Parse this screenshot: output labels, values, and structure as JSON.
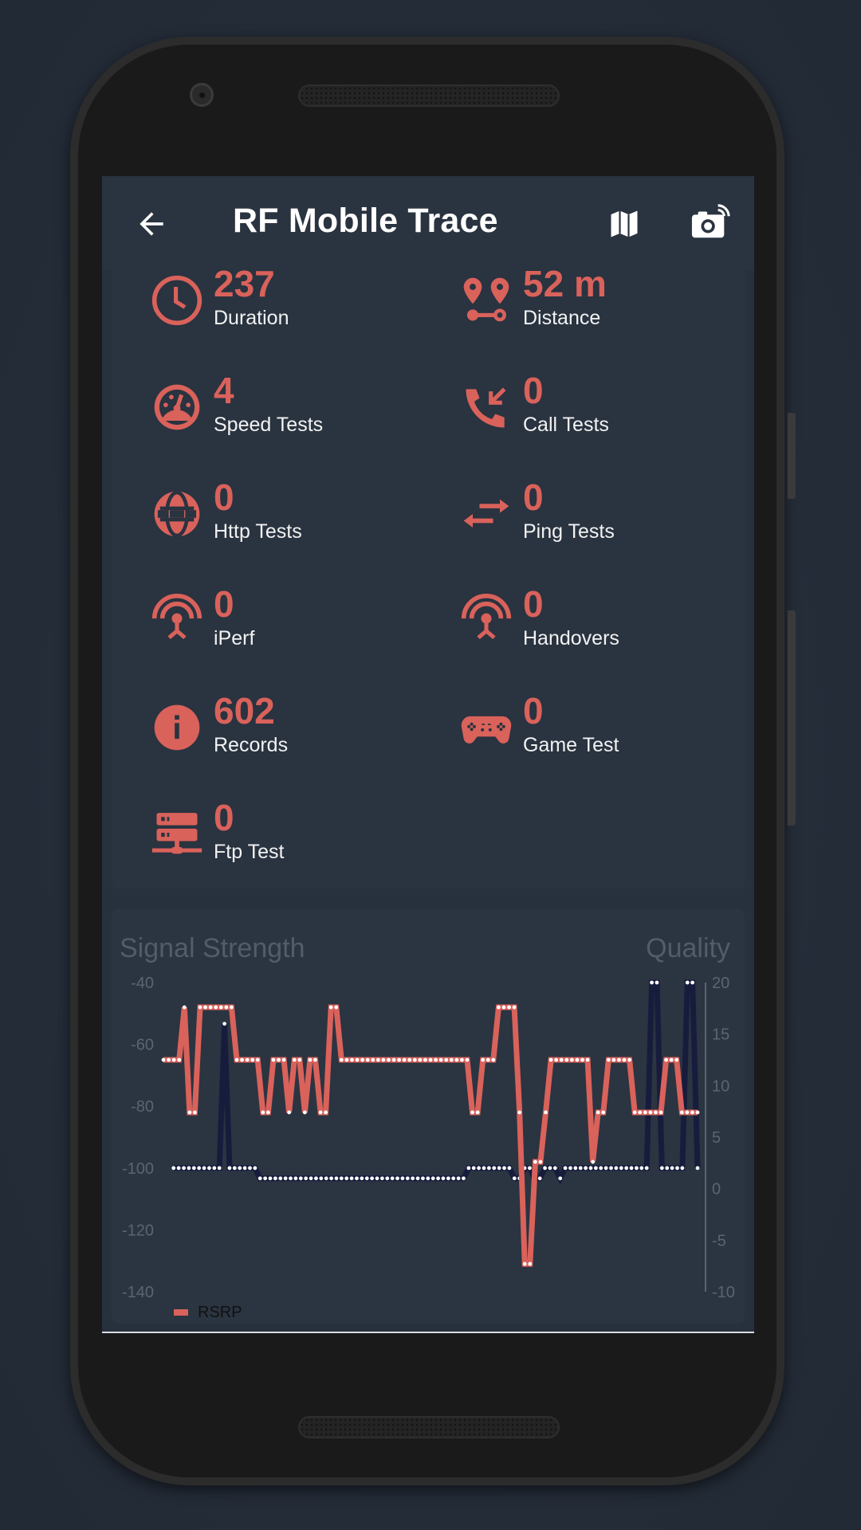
{
  "app": {
    "title": "RF Mobile Trace",
    "back_icon": "arrow-left-icon",
    "actions": [
      {
        "name": "map",
        "icon": "map-icon"
      },
      {
        "name": "camera",
        "icon": "camera-wireless-icon"
      }
    ]
  },
  "stats": [
    {
      "value": "237",
      "label": "Duration",
      "icon": "clock-icon"
    },
    {
      "value": "52 m",
      "label": "Distance",
      "icon": "route-pins-icon"
    },
    {
      "value": "4",
      "label": "Speed Tests",
      "icon": "speedometer-icon"
    },
    {
      "value": "0",
      "label": "Call Tests",
      "icon": "phone-incoming-icon"
    },
    {
      "value": "0",
      "label": "Http Tests",
      "icon": "globe-icon"
    },
    {
      "value": "0",
      "label": "Ping Tests",
      "icon": "swap-arrows-icon"
    },
    {
      "value": "0",
      "label": "iPerf",
      "icon": "antenna-icon"
    },
    {
      "value": "0",
      "label": "Handovers",
      "icon": "antenna-icon"
    },
    {
      "value": "602",
      "label": "Records",
      "icon": "info-icon"
    },
    {
      "value": "0",
      "label": "Game Test",
      "icon": "gamepad-icon"
    },
    {
      "value": "0",
      "label": "Ftp Test",
      "icon": "server-network-icon"
    }
  ],
  "colors": {
    "accent": "#d9625b",
    "background": "#27303d",
    "card": "#2a3340",
    "quality_line": "#171c3d"
  },
  "chart_data": {
    "type": "line",
    "title_left": "Signal Strength",
    "title_right": "Quality",
    "left_axis": {
      "ticks": [
        "-40",
        "-60",
        "-80",
        "-100",
        "-120",
        "-140"
      ],
      "range": [
        -140,
        -40
      ]
    },
    "right_axis": {
      "ticks": [
        "20",
        "15",
        "10",
        "5",
        "0",
        "-5",
        "-10"
      ],
      "range": [
        -10,
        20
      ]
    },
    "legend": [
      {
        "name": "RSRP",
        "color": "#d9625b",
        "position": "bottom-left"
      }
    ],
    "series": [
      {
        "name": "RSRP",
        "axis": "left",
        "values": [
          -65,
          -65,
          -65,
          -65,
          -48,
          -82,
          -82,
          -48,
          -48,
          -48,
          -48,
          -48,
          -48,
          -48,
          -65,
          -65,
          -65,
          -65,
          -65,
          -82,
          -82,
          -65,
          -65,
          -65,
          -82,
          -65,
          -65,
          -82,
          -65,
          -65,
          -82,
          -82,
          -48,
          -48,
          -65,
          -65,
          -65,
          -65,
          -65,
          -65,
          -65,
          -65,
          -65,
          -65,
          -65,
          -65,
          -65,
          -65,
          -65,
          -65,
          -65,
          -65,
          -65,
          -65,
          -65,
          -65,
          -65,
          -65,
          -65,
          -82,
          -82,
          -65,
          -65,
          -65,
          -48,
          -48,
          -48,
          -48,
          -82,
          -131,
          -131,
          -98,
          -98,
          -82,
          -65,
          -65,
          -65,
          -65,
          -65,
          -65,
          -65,
          -65,
          -98,
          -82,
          -82,
          -65,
          -65,
          -65,
          -65,
          -65,
          -82,
          -82,
          -82,
          -82,
          -82,
          -82,
          -65,
          -65,
          -65,
          -82,
          -82,
          -82,
          -82
        ]
      },
      {
        "name": "Quality",
        "axis": "right",
        "values": [
          null,
          null,
          2,
          2,
          2,
          2,
          2,
          2,
          2,
          2,
          2,
          2,
          16,
          2,
          2,
          2,
          2,
          2,
          2,
          1,
          1,
          1,
          1,
          1,
          1,
          1,
          1,
          1,
          1,
          1,
          1,
          1,
          1,
          1,
          1,
          1,
          1,
          1,
          1,
          1,
          1,
          1,
          1,
          1,
          1,
          1,
          1,
          1,
          1,
          1,
          1,
          1,
          1,
          1,
          1,
          1,
          1,
          1,
          1,
          1,
          2,
          2,
          2,
          2,
          2,
          2,
          2,
          2,
          2,
          1,
          1,
          2,
          2,
          1,
          1,
          2,
          2,
          2,
          1,
          2,
          2,
          2,
          2,
          2,
          2,
          2,
          2,
          2,
          2,
          2,
          2,
          2,
          2,
          2,
          2,
          2,
          20,
          20,
          2,
          2,
          2,
          2,
          2,
          20,
          20,
          2
        ]
      }
    ]
  }
}
